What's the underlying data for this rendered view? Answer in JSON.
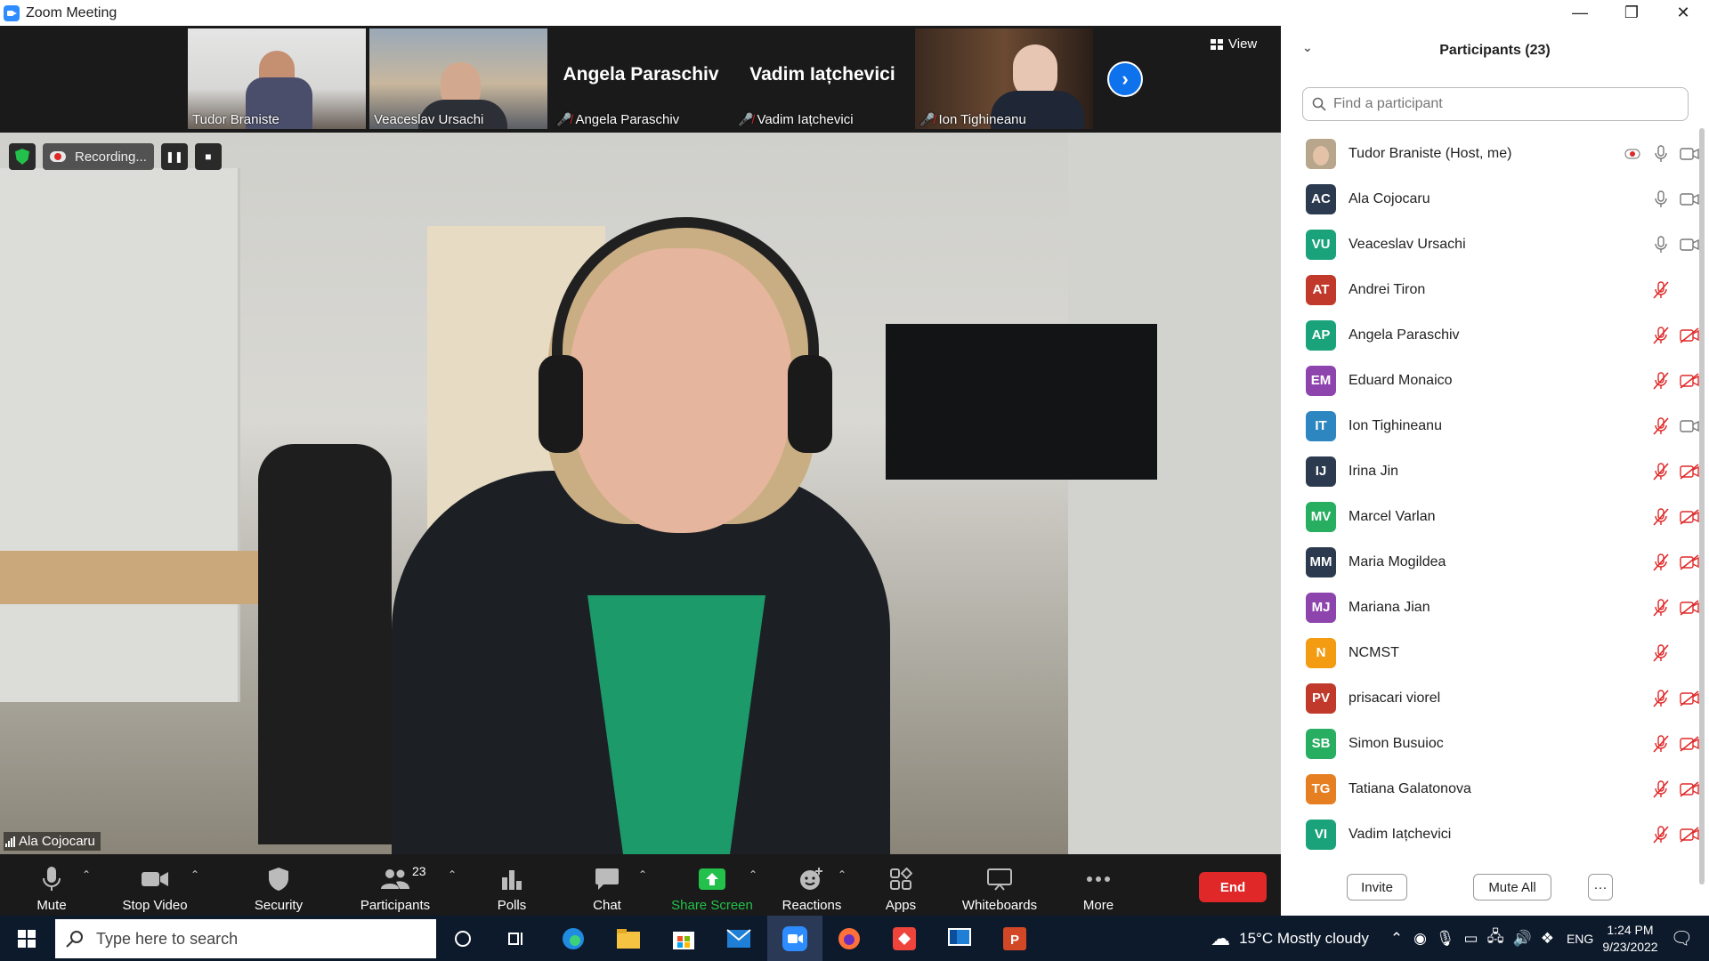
{
  "window": {
    "title": "Zoom Meeting",
    "minimize": "—",
    "restore": "❐",
    "close": "✕"
  },
  "filmstrip": {
    "tiles": [
      {
        "name": "Tudor Braniste",
        "muted": false,
        "video": true
      },
      {
        "name": "Veaceslav Ursachi",
        "muted": false,
        "video": true
      },
      {
        "name": "Angela Paraschiv",
        "muted": true,
        "video": false,
        "big_name": "Angela Paraschiv"
      },
      {
        "name": "Vadim Iațchevici",
        "muted": true,
        "video": false,
        "big_name": "Vadim Iațchevici"
      },
      {
        "name": "Ion Tighineanu",
        "muted": true,
        "video": true
      }
    ],
    "view_label": "View"
  },
  "main_video": {
    "speaker_name": "Ala Cojocaru",
    "recording_label": "Recording..."
  },
  "toolbar": {
    "mute": "Mute",
    "stop_video": "Stop Video",
    "security": "Security",
    "participants": "Participants",
    "participants_count": "23",
    "polls": "Polls",
    "chat": "Chat",
    "share_screen": "Share Screen",
    "reactions": "Reactions",
    "apps": "Apps",
    "whiteboards": "Whiteboards",
    "more": "More",
    "end": "End",
    "share_color": "#23c04b",
    "end_color": "#e02828"
  },
  "panel": {
    "title": "Participants (23)",
    "search_placeholder": "Find a participant",
    "participants": [
      {
        "initials": "",
        "name": "Tudor Braniste (Host, me)",
        "color": "photo",
        "recording": true,
        "mic": "on",
        "video": "on"
      },
      {
        "initials": "AC",
        "name": "Ala Cojocaru",
        "color": "#2b3a4e",
        "mic": "on",
        "video": "on"
      },
      {
        "initials": "VU",
        "name": "Veaceslav Ursachi",
        "color": "#1aa37a",
        "mic": "on",
        "video": "on"
      },
      {
        "initials": "AT",
        "name": "Andrei Tiron",
        "color": "#c0392b",
        "mic": "off",
        "video": "none"
      },
      {
        "initials": "AP",
        "name": "Angela Paraschiv",
        "color": "#1aa37a",
        "mic": "off",
        "video": "off"
      },
      {
        "initials": "EM",
        "name": "Eduard Monaico",
        "color": "#8e44ad",
        "mic": "off",
        "video": "off"
      },
      {
        "initials": "IT",
        "name": "Ion Tighineanu",
        "color": "#2e86c1",
        "mic": "off",
        "video": "on"
      },
      {
        "initials": "IJ",
        "name": "Irina Jin",
        "color": "#2b3a4e",
        "mic": "off",
        "video": "off"
      },
      {
        "initials": "MV",
        "name": "Marcel Varlan",
        "color": "#27ae60",
        "mic": "off",
        "video": "off"
      },
      {
        "initials": "MM",
        "name": "Maria Mogildea",
        "color": "#2b3a4e",
        "mic": "off",
        "video": "off"
      },
      {
        "initials": "MJ",
        "name": "Mariana Jian",
        "color": "#8e44ad",
        "mic": "off",
        "video": "off"
      },
      {
        "initials": "N",
        "name": "NCMST",
        "color": "#f39c12",
        "mic": "off",
        "video": "none"
      },
      {
        "initials": "PV",
        "name": "prisacari viorel",
        "color": "#c0392b",
        "mic": "off",
        "video": "off"
      },
      {
        "initials": "SB",
        "name": "Simon Busuioc",
        "color": "#27ae60",
        "mic": "off",
        "video": "off"
      },
      {
        "initials": "TG",
        "name": "Tatiana Galatonova",
        "color": "#e67e22",
        "mic": "off",
        "video": "off"
      },
      {
        "initials": "VI",
        "name": "Vadim Iațchevici",
        "color": "#1aa37a",
        "mic": "off",
        "video": "off"
      }
    ],
    "invite": "Invite",
    "mute_all": "Mute All",
    "more": "···"
  },
  "taskbar": {
    "search_placeholder": "Type here to search",
    "weather": "15°C  Mostly cloudy",
    "language": "ENG",
    "time": "1:24 PM",
    "date": "9/23/2022"
  }
}
